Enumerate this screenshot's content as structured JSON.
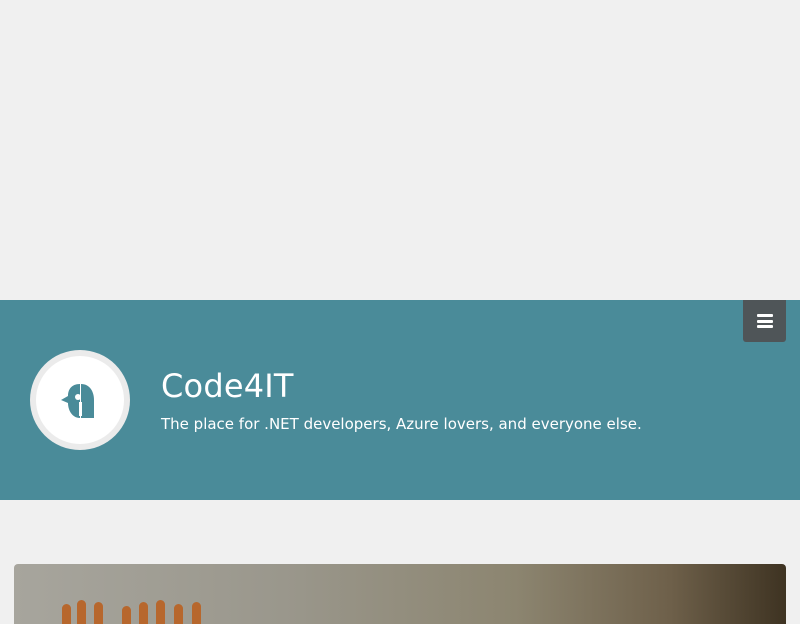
{
  "header": {
    "site_title": "Code4IT",
    "tagline": "The place for .NET developers, Azure lovers, and everyone else.",
    "menu_icon": "hamburger-menu-icon",
    "logo_icon": "penguin-logo-icon",
    "background_color": "#4a8b99",
    "menu_button_color": "#4f5558"
  },
  "page": {
    "background_color": "#f0f0f0"
  },
  "hero": {
    "image_subject": "hands-photo"
  }
}
